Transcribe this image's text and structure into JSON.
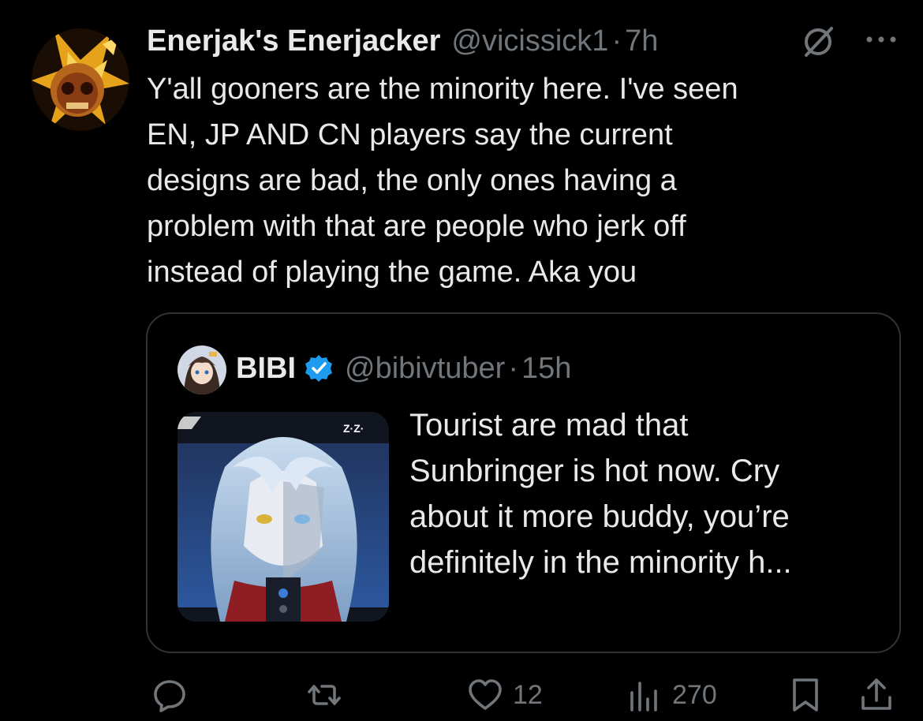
{
  "tweet": {
    "display_name": "Enerjak's Enerjacker",
    "handle": "@vicissick1",
    "separator": "·",
    "time": "7h",
    "text": "Y'all gooners are the minority here. I've seen\nEN, JP AND CN players say the current\ndesigns are bad, the only ones having a\nproblem with that are people who jerk off\ninstead of playing the game. Aka you",
    "icons": {
      "grok": "grok-icon",
      "more": "more-options-icon"
    }
  },
  "quote": {
    "display_name": "BIBI",
    "verified": true,
    "handle": "@bibivtuber",
    "separator": "·",
    "time": "15h",
    "text": "Tourist are mad that\nSunbringer is hot now. Cry\nabout it more buddy, you’re\ndefinitely in the minority h...",
    "image_text": "Z·Z·"
  },
  "actions": {
    "reply": {
      "icon": "reply-icon",
      "count": ""
    },
    "repost": {
      "icon": "repost-icon",
      "count": ""
    },
    "like": {
      "icon": "heart-icon",
      "count": "12"
    },
    "views": {
      "icon": "views-icon",
      "count": "270"
    },
    "bookmark": {
      "icon": "bookmark-icon"
    },
    "share": {
      "icon": "share-icon"
    }
  },
  "colors": {
    "background": "#000000",
    "text": "#e7e9ea",
    "secondary": "#71767b",
    "border": "#2f3336",
    "verified": "#1d9bf0"
  }
}
